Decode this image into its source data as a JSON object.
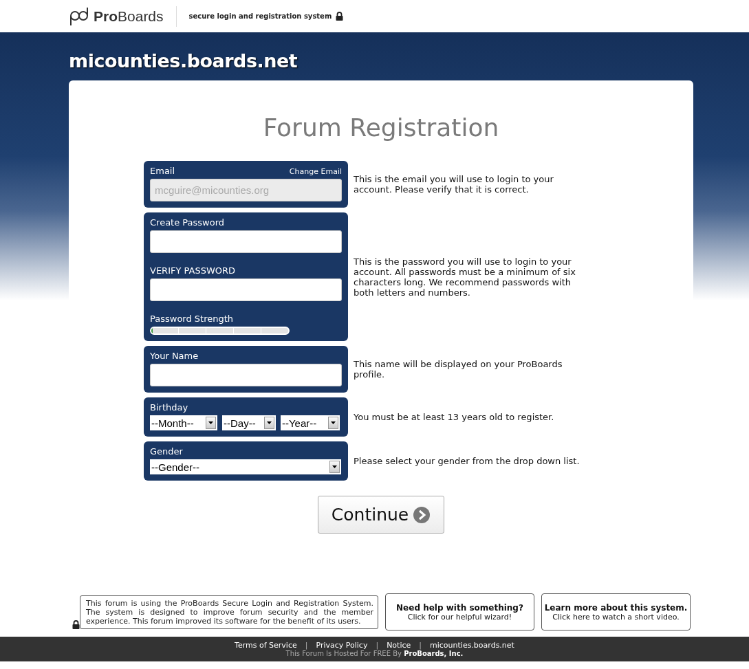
{
  "header": {
    "logo": "**Pro**Boards",
    "tagline": "secure login and registration system"
  },
  "site_title": "micounties.boards.net",
  "heading": "Forum Registration",
  "sections": [
    {
      "kind": "email",
      "label": "Email",
      "link": "Change Email",
      "value": "mcguire@micounties.org",
      "disabled": true,
      "description": "This is the email you will use to login to your account. Please verify that it is correct."
    },
    {
      "kind": "password",
      "label": "Create Password",
      "verify_label": "VERIFY PASSWORD",
      "strength_label": "Password Strength",
      "level": 0,
      "description": "This is the password you will use to login to your account. All passwords must be a minimum of six characters long. We recommend passwords with both letters and numbers."
    },
    {
      "kind": "text",
      "label": "Your Name",
      "description": "This name will be displayed on your ProBoards profile."
    },
    {
      "kind": "birthday",
      "label": "Birthday",
      "selects": [
        "--Month--",
        "--Day--",
        "--Year--"
      ],
      "description": "You must be at least 13 years old to register."
    },
    {
      "kind": "select",
      "label": "Gender",
      "selects": [
        "--Gender--"
      ],
      "description": "Please select your gender from the drop down list."
    }
  ],
  "continue_button": "Continue",
  "info_boxes": [
    {
      "kind": "notice",
      "text": "This forum is using the ProBoards Secure Login and Registration System. The system is designed to improve forum security and the member experience. This forum improved its software for the benefit of its users."
    },
    {
      "kind": "link",
      "title": "Need help with something?",
      "text": "Click for our helpful wizard!"
    },
    {
      "kind": "link",
      "title": "Learn more about this system.",
      "text": "Click here to watch a short video."
    }
  ],
  "footer": {
    "links": [
      "Terms of Service",
      "Privacy Policy",
      "Notice",
      "micounties.boards.net"
    ],
    "separator": "|",
    "hosted": "This Forum Is Hosted For FREE By **ProBoards, Inc.**"
  }
}
